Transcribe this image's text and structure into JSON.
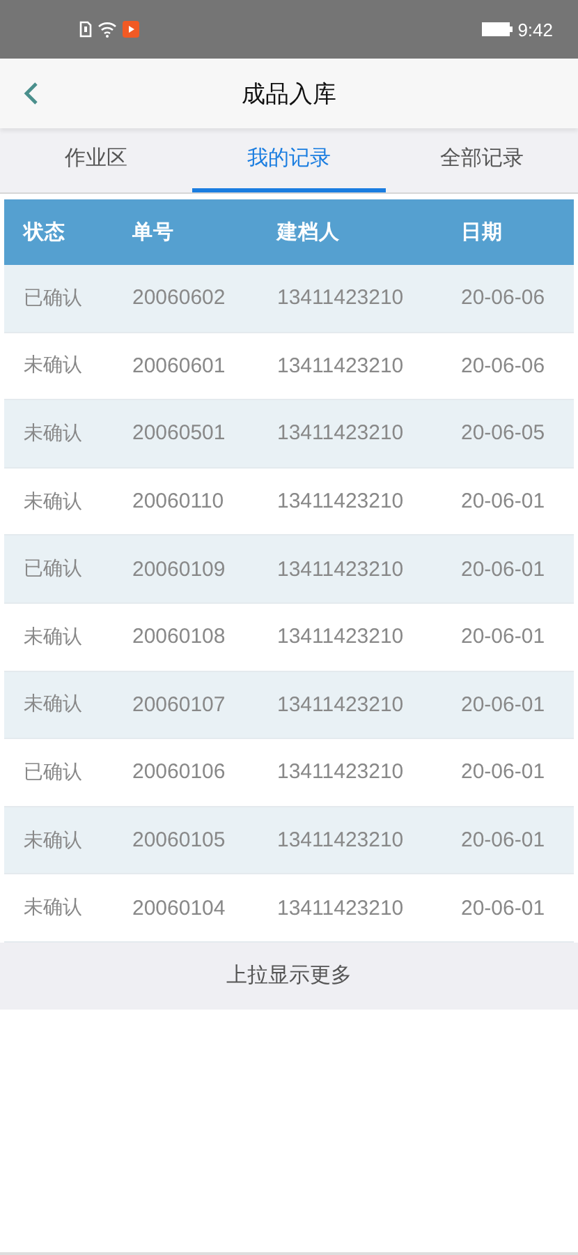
{
  "status_bar": {
    "time": "9:42"
  },
  "header": {
    "title": "成品入库"
  },
  "tabs": [
    {
      "label": "作业区",
      "selected": false
    },
    {
      "label": "我的记录",
      "selected": true
    },
    {
      "label": "全部记录",
      "selected": false
    }
  ],
  "table": {
    "columns": [
      "状态",
      "单号",
      "建档人",
      "日期"
    ],
    "rows": [
      [
        "已确认",
        "20060602",
        "13411423210",
        "20-06-06"
      ],
      [
        "未确认",
        "20060601",
        "13411423210",
        "20-06-06"
      ],
      [
        "未确认",
        "20060501",
        "13411423210",
        "20-06-05"
      ],
      [
        "未确认",
        "20060110",
        "13411423210",
        "20-06-01"
      ],
      [
        "已确认",
        "20060109",
        "13411423210",
        "20-06-01"
      ],
      [
        "未确认",
        "20060108",
        "13411423210",
        "20-06-01"
      ],
      [
        "未确认",
        "20060107",
        "13411423210",
        "20-06-01"
      ],
      [
        "已确认",
        "20060106",
        "13411423210",
        "20-06-01"
      ],
      [
        "未确认",
        "20060105",
        "13411423210",
        "20-06-01"
      ],
      [
        "未确认",
        "20060104",
        "13411423210",
        "20-06-01"
      ]
    ]
  },
  "load_more": "上拉显示更多"
}
